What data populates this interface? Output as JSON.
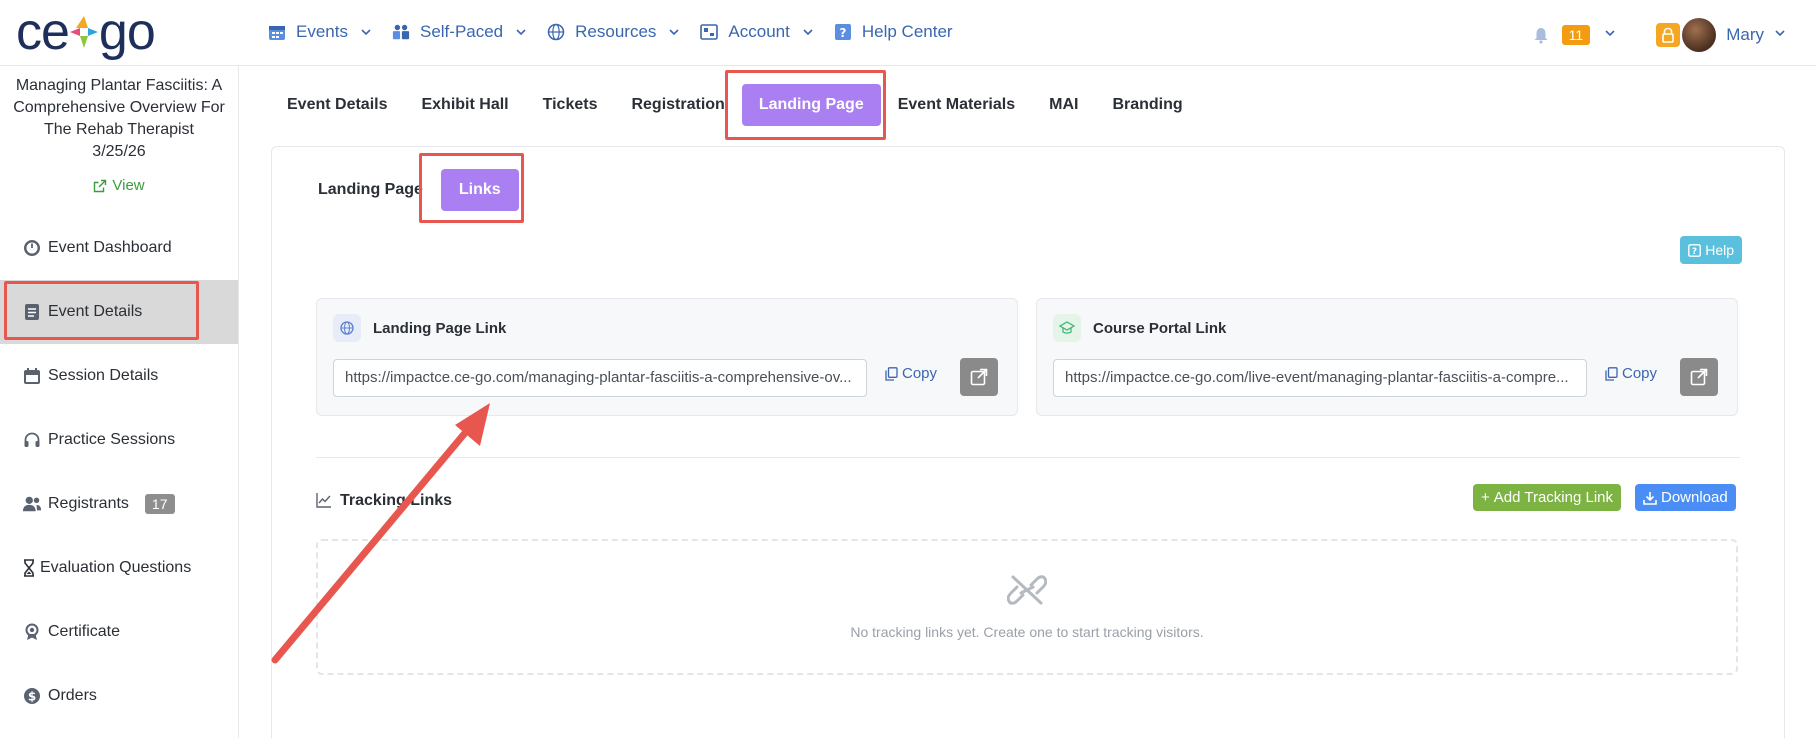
{
  "brand": {
    "logo_text_left": "ce",
    "logo_text_right": "go"
  },
  "topnav": {
    "items": [
      {
        "label": "Events",
        "icon": "calendar-icon"
      },
      {
        "label": "Self-Paced",
        "icon": "users-icon"
      },
      {
        "label": "Resources",
        "icon": "globe-icon"
      },
      {
        "label": "Account",
        "icon": "account-icon"
      },
      {
        "label": "Help Center",
        "icon": "question-icon"
      }
    ],
    "notifications_count": "11",
    "user_name": "Mary"
  },
  "sidebar": {
    "event_title_lines": [
      "Managing Plantar Fasciitis: A",
      "Comprehensive Overview For",
      "The Rehab Therapist",
      "3/25/26"
    ],
    "view_label": "View",
    "items": [
      {
        "label": "Event Dashboard",
        "icon": "dashboard-icon"
      },
      {
        "label": "Event Details",
        "icon": "details-icon",
        "active": true
      },
      {
        "label": "Session Details",
        "icon": "calendar-icon"
      },
      {
        "label": "Practice Sessions",
        "icon": "headset-icon"
      },
      {
        "label": "Registrants",
        "icon": "users-icon",
        "badge": "17"
      },
      {
        "label": "Evaluation Questions",
        "icon": "hourglass-icon"
      },
      {
        "label": "Certificate",
        "icon": "award-icon"
      },
      {
        "label": "Orders",
        "icon": "dollar-icon"
      }
    ]
  },
  "tabs": {
    "items": [
      "Event Details",
      "Exhibit Hall",
      "Tickets",
      "Registration",
      "Landing Page",
      "Event Materials",
      "MAI",
      "Branding"
    ],
    "active": "Landing Page"
  },
  "subtabs": {
    "items": [
      "Landing Page",
      "Links"
    ],
    "active": "Links"
  },
  "help_label": "Help",
  "landing_link": {
    "title": "Landing Page Link",
    "url": "https://impactce.ce-go.com/managing-plantar-fasciitis-a-comprehensive-ov...",
    "copy_label": "Copy"
  },
  "portal_link": {
    "title": "Course Portal Link",
    "url": "https://impactce.ce-go.com/live-event/managing-plantar-fasciitis-a-compre...",
    "copy_label": "Copy"
  },
  "tracking": {
    "title": "Tracking Links",
    "add_label": "Add Tracking Link",
    "download_label": "Download",
    "empty_text": "No tracking links yet. Create one to start tracking visitors."
  },
  "colors": {
    "accent_purple": "#a97ff2",
    "nav_blue": "#3a66b0",
    "annotation_red": "#e8574f",
    "add_green": "#7cb342",
    "download_blue": "#4a8ef5",
    "help_cyan": "#5bc0de"
  }
}
